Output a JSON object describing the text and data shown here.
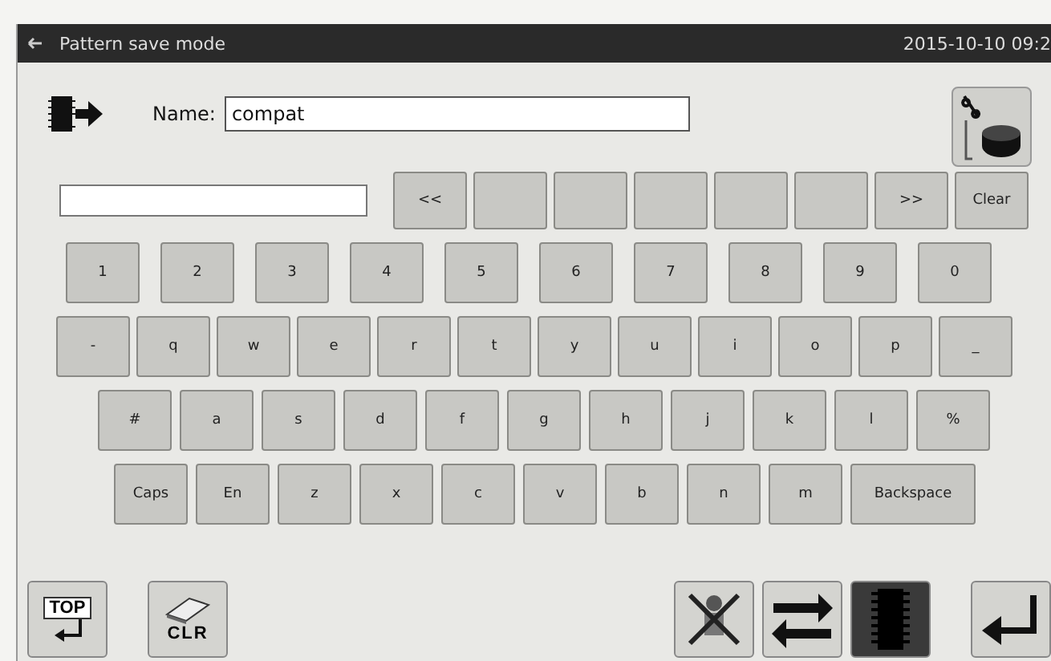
{
  "title_bar": {
    "title": "Pattern save mode",
    "datetime": "2015-10-10 09:2"
  },
  "name_field": {
    "label": "Name:",
    "value": "compat"
  },
  "candidate_bar": {
    "keys": [
      {
        "kind": "text",
        "label": "<<"
      },
      {
        "kind": "blank"
      },
      {
        "kind": "blank"
      },
      {
        "kind": "blank"
      },
      {
        "kind": "blank"
      },
      {
        "kind": "blank"
      },
      {
        "kind": "text",
        "label": ">>"
      },
      {
        "kind": "text",
        "label": "Clear"
      }
    ]
  },
  "keyboard": {
    "rows": [
      [
        {
          "kind": "text",
          "label": "1"
        },
        {
          "kind": "text",
          "label": "2"
        },
        {
          "kind": "text",
          "label": "3"
        },
        {
          "kind": "text",
          "label": "4"
        },
        {
          "kind": "text",
          "label": "5"
        },
        {
          "kind": "text",
          "label": "6"
        },
        {
          "kind": "text",
          "label": "7"
        },
        {
          "kind": "text",
          "label": "8"
        },
        {
          "kind": "text",
          "label": "9"
        },
        {
          "kind": "text",
          "label": "0"
        }
      ],
      [
        {
          "kind": "text",
          "label": "-"
        },
        {
          "kind": "text",
          "label": "q"
        },
        {
          "kind": "text",
          "label": "w"
        },
        {
          "kind": "text",
          "label": "e"
        },
        {
          "kind": "text",
          "label": "r"
        },
        {
          "kind": "text",
          "label": "t"
        },
        {
          "kind": "text",
          "label": "y"
        },
        {
          "kind": "text",
          "label": "u"
        },
        {
          "kind": "text",
          "label": "i"
        },
        {
          "kind": "text",
          "label": "o"
        },
        {
          "kind": "text",
          "label": "p"
        },
        {
          "kind": "text",
          "label": "_"
        }
      ],
      [
        {
          "kind": "text",
          "label": "#"
        },
        {
          "kind": "text",
          "label": "a"
        },
        {
          "kind": "text",
          "label": "s"
        },
        {
          "kind": "text",
          "label": "d"
        },
        {
          "kind": "text",
          "label": "f"
        },
        {
          "kind": "text",
          "label": "g"
        },
        {
          "kind": "text",
          "label": "h"
        },
        {
          "kind": "text",
          "label": "j"
        },
        {
          "kind": "text",
          "label": "k"
        },
        {
          "kind": "text",
          "label": "l"
        },
        {
          "kind": "text",
          "label": "%"
        }
      ],
      [
        {
          "kind": "text",
          "label": "Caps"
        },
        {
          "kind": "text",
          "label": "En"
        },
        {
          "kind": "text",
          "label": "z"
        },
        {
          "kind": "text",
          "label": "x"
        },
        {
          "kind": "text",
          "label": "c"
        },
        {
          "kind": "text",
          "label": "v"
        },
        {
          "kind": "text",
          "label": "b"
        },
        {
          "kind": "text",
          "label": "n"
        },
        {
          "kind": "text",
          "label": "m"
        },
        {
          "kind": "wide",
          "label": "Backspace"
        }
      ]
    ]
  },
  "bottom_buttons": {
    "top": "TOP",
    "clear": "CLR"
  }
}
